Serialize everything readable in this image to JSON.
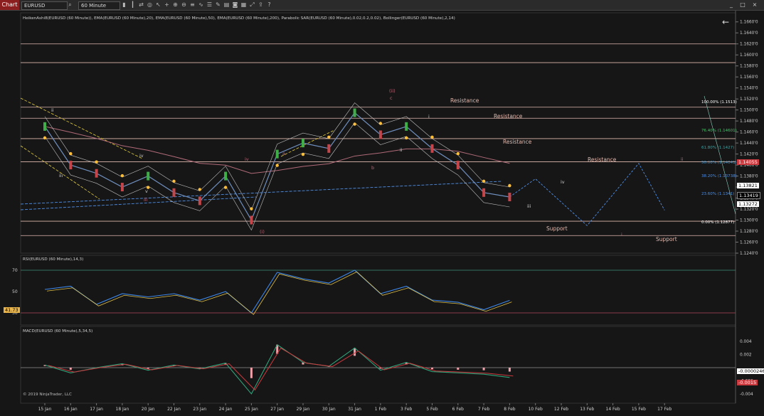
{
  "toolbar": {
    "tab_label": "Chart",
    "instrument": "EURUSD",
    "period": "60 Minute",
    "icons": [
      "search-icon",
      "bar-type-icon",
      "candles-icon",
      "sync-icon",
      "zoom-icon",
      "pointer-icon",
      "crosshair-icon",
      "zoom-in-icon",
      "zoom-out-icon",
      "strategy-icon",
      "indicator-icon",
      "properties-icon",
      "drawing-icon",
      "list-icon",
      "camera-icon",
      "grid-icon",
      "expand-icon",
      "share-icon",
      "question-icon",
      "template-icon"
    ]
  },
  "window": {
    "minimize": "_",
    "maximize": "□",
    "close": "×",
    "back_arrow": "←"
  },
  "colors": {
    "background": "#161616",
    "candle_up": "#3fae49",
    "candle_down": "#c4464a",
    "sar": "#ffbf3a",
    "ema20": "#6f8fbf",
    "ema200": "#b06a78",
    "bollinger": "#bdbdbd",
    "resistance": "#e0b8ae",
    "trend_blue": "#4d8fe8"
  },
  "price_panel": {
    "indicator_header": "HeikenAshi8(EURUSD (60 Minute)), EMA(EURUSD (60 Minute),20), EMA(EURUSD (60 Minute),50), EMA(EURUSD (60 Minute),200), Parabolic SAR(EURUSD (60 Minute),0.02,0.2,0.02), Bollinger(EURUSD (60 Minute),2,14)",
    "y_ticks": [
      "1.1660'0",
      "1.1640'0",
      "1.1620'0",
      "1.1600'0",
      "1.1580'0",
      "1.1560'0",
      "1.1540'0",
      "1.1520'0",
      "1.1500'0",
      "1.1480'0",
      "1.1460'0",
      "1.1440'0",
      "1.1420'0",
      "1.1400'0",
      "1.1380'0",
      "1.1360'0",
      "1.1340'0",
      "1.1320'0",
      "1.1300'0",
      "1.1280'0",
      "1.1260'0",
      "1.1240'0"
    ],
    "last_prices": [
      "1.14055",
      "1.13821",
      "1.13419",
      "1.13272"
    ],
    "fib_levels": [
      "100.00% (1.1513)",
      "76.40% (1.14601)",
      "61.80% (1.1427)",
      "50.00% (1.14041)",
      "38.20% (1.13738)",
      "23.60% (1.1341)",
      "0.00% (1.12877)"
    ],
    "sr_labels": {
      "r1": "Resistance",
      "r2": "Resistance",
      "r3": "Resistance",
      "r4": "Resistance",
      "s1": "Support",
      "s2": "Support"
    },
    "wave_labels": {
      "ii_a": "ii",
      "iii": "iii",
      "iv_a": "iv",
      "v_a": "v",
      "iii_b": "iii",
      "iv_b": "iv",
      "i_left": "(i)",
      "a": "a",
      "b": "b",
      "c": "c",
      "ii_top": "(ii)",
      "i_b": "i",
      "ii_b": "ii",
      "iii_c": "iii",
      "iv_c": "iv",
      "i_c": "i",
      "ii_c": "ii"
    }
  },
  "rsi_panel": {
    "label": "RSI(EURUSD (60 Minute),14,3)",
    "y_ticks": [
      "70",
      "50",
      "30"
    ],
    "current": "41.73"
  },
  "macd_panel": {
    "label": "MACD(EURUSD (60 Minute),5,34,5)",
    "y_ticks": [
      "0.004",
      "0.002",
      "-0.002",
      "-0.004"
    ],
    "current_a": "-0.0000246",
    "current_b": "-0.0015",
    "copyright": "© 2019 NinjaTrader, LLC"
  },
  "x_axis": {
    "ticks": [
      "15 Jan",
      "16 Jan",
      "17 Jan",
      "18 Jan",
      "20 Jan",
      "22 Jan",
      "23 Jan",
      "24 Jan",
      "25 Jan",
      "27 Jan",
      "29 Jan",
      "30 Jan",
      "31 Jan",
      "1 Feb",
      "3 Feb",
      "5 Feb",
      "6 Feb",
      "7 Feb",
      "8 Feb",
      "10 Feb",
      "12 Feb",
      "13 Feb",
      "14 Feb",
      "15 Feb",
      "17 Feb"
    ]
  },
  "chart_data": {
    "type": "line",
    "title": "",
    "xlabel": "",
    "ylabel": "",
    "x": [
      "15 Jan",
      "16 Jan",
      "17 Jan",
      "18 Jan",
      "20 Jan",
      "22 Jan",
      "23 Jan",
      "24 Jan",
      "25 Jan",
      "27 Jan",
      "29 Jan",
      "30 Jan",
      "31 Jan",
      "1 Feb",
      "3 Feb",
      "5 Feb",
      "6 Feb",
      "7 Feb",
      "8 Feb"
    ],
    "series": [
      {
        "values": [
          1.147,
          1.14,
          1.1385,
          1.136,
          1.138,
          1.135,
          1.1335,
          1.138,
          1.13,
          1.142,
          1.144,
          1.143,
          1.1495,
          1.1455,
          1.147,
          1.143,
          1.14,
          1.135,
          1.1342
        ]
      }
    ],
    "ylim": [
      1.124,
      1.167
    ],
    "horizontal_lines": [
      1.162,
      1.1586,
      1.1505,
      1.1485,
      1.1448,
      1.1406,
      1.1298,
      1.1272
    ],
    "projection": {
      "x": [
        "8 Feb",
        "10 Feb",
        "13 Feb",
        "15 Feb",
        "17 Feb"
      ],
      "values": [
        1.1342,
        1.1375,
        1.129,
        1.1403,
        1.1318
      ]
    },
    "rsi": {
      "values": [
        52,
        55,
        38,
        48,
        45,
        48,
        42,
        50,
        30,
        68,
        62,
        58,
        70,
        48,
        55,
        42,
        40,
        33,
        41.73
      ],
      "ylim": [
        20,
        80
      ],
      "levels": [
        70,
        30
      ]
    },
    "macd": {
      "values": [
        0.0004,
        -0.0008,
        0.0,
        0.0006,
        -0.0004,
        0.0004,
        -0.0002,
        0.0007,
        -0.004,
        0.0035,
        0.0008,
        0.0002,
        0.003,
        -0.0004,
        0.0008,
        -0.0006,
        -0.0008,
        -0.001,
        -0.0015
      ],
      "ylim": [
        -0.0052,
        0.0052
      ]
    },
    "grid": false
  }
}
